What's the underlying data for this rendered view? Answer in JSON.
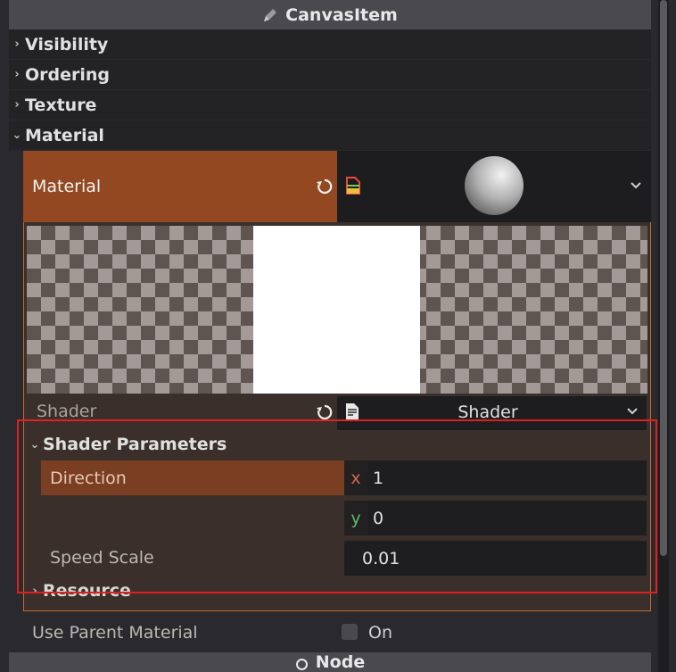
{
  "header": {
    "title": "CanvasItem",
    "icon": "pencil-icon"
  },
  "categories": [
    {
      "label": "Visibility",
      "expanded": false
    },
    {
      "label": "Ordering",
      "expanded": false
    },
    {
      "label": "Texture",
      "expanded": false
    },
    {
      "label": "Material",
      "expanded": true
    }
  ],
  "material": {
    "label": "Material",
    "resource_icon": "shader-material-icon",
    "preview_icon": "sphere-preview",
    "reset_icon": "revert-icon",
    "dropdown_icon": "chevron-down-icon"
  },
  "shader": {
    "label": "Shader",
    "value": "Shader",
    "resource_icon": "shader-file-icon"
  },
  "shader_parameters": {
    "label": "Shader Parameters",
    "direction": {
      "label": "Direction",
      "x_axis": "x",
      "x": "1",
      "y_axis": "y",
      "y": "0"
    },
    "speed_scale": {
      "label": "Speed Scale",
      "value": "0.01"
    }
  },
  "resource": {
    "label": "Resource"
  },
  "use_parent_material": {
    "label": "Use Parent Material",
    "checkbox_label": "On",
    "checked": false
  },
  "footer": {
    "title": "Node",
    "icon": "node-circle-icon"
  },
  "colors": {
    "accent_orange": "#944821",
    "direction_orange": "#7a3e22",
    "frame_red": "#e02020",
    "axis_x": "#d06a4a",
    "axis_y": "#5aba6a"
  }
}
